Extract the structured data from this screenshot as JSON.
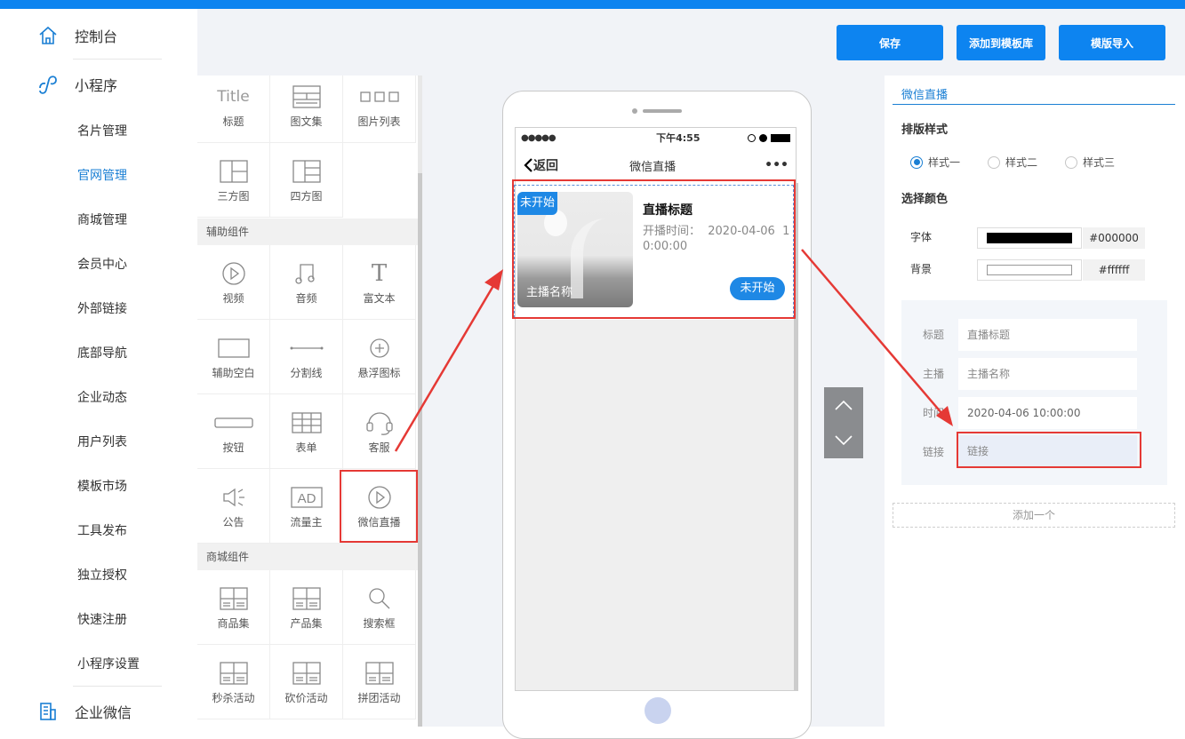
{
  "sidebar": {
    "console": "控制台",
    "miniprogram": "小程序",
    "items": [
      "名片管理",
      "官网管理",
      "商城管理",
      "会员中心",
      "外部链接",
      "底部导航",
      "企业动态",
      "用户列表",
      "模板市场",
      "工具发布",
      "独立授权",
      "快速注册",
      "小程序设置"
    ],
    "active_index": 1,
    "wework": "企业微信"
  },
  "header": {
    "save_label": "保存",
    "add_to_lib_label": "添加到模板库",
    "import_label": "模版导入"
  },
  "components": {
    "basic": [
      {
        "icon": "title-text-icon",
        "icon_text": "Title",
        "label": "标题"
      },
      {
        "icon": "image-text-set-icon",
        "label": "图文集"
      },
      {
        "icon": "image-list-icon",
        "label": "图片列表"
      },
      {
        "icon": "three-grid-icon",
        "label": "三方图"
      },
      {
        "icon": "four-grid-icon",
        "label": "四方图"
      }
    ],
    "aux_title": "辅助组件",
    "aux": [
      {
        "icon": "video-icon",
        "label": "视频"
      },
      {
        "icon": "audio-icon",
        "label": "音频"
      },
      {
        "icon": "rich-text-icon",
        "icon_text": "T",
        "label": "富文本"
      },
      {
        "icon": "blank-space-icon",
        "label": "辅助空白"
      },
      {
        "icon": "divider-icon",
        "label": "分割线"
      },
      {
        "icon": "float-icon",
        "label": "悬浮图标"
      },
      {
        "icon": "button-icon",
        "label": "按钮"
      },
      {
        "icon": "form-icon",
        "label": "表单"
      },
      {
        "icon": "customer-service-icon",
        "label": "客服"
      },
      {
        "icon": "announcement-icon",
        "label": "公告"
      },
      {
        "icon": "ad-icon",
        "icon_text": "AD",
        "label": "流量主"
      },
      {
        "icon": "wechat-live-icon",
        "label": "微信直播"
      }
    ],
    "mall_title": "商城组件",
    "mall": [
      {
        "icon": "goods-set-icon",
        "label": "商品集"
      },
      {
        "icon": "product-set-icon",
        "label": "产品集"
      },
      {
        "icon": "search-box-icon",
        "label": "搜索框"
      },
      {
        "icon": "flash-sale-icon",
        "label": "秒杀活动"
      },
      {
        "icon": "bargain-icon",
        "label": "砍价活动"
      },
      {
        "icon": "group-buy-icon",
        "label": "拼团活动"
      }
    ]
  },
  "phone": {
    "status_time": "下午4:55",
    "signal": "●●●●●",
    "back_label": "返回",
    "page_title": "微信直播",
    "more": "•••",
    "live_card": {
      "badge": "未开始",
      "anchor": "主播名称",
      "title": "直播标题",
      "time_label": "开播时间：",
      "time_value": "2020-04-06 10:00:00",
      "time_line1": "开播时间：  2020-04-06  1",
      "time_line2": "0:00:00",
      "status_button": "未开始"
    }
  },
  "settings": {
    "tab": "微信直播",
    "layout_title": "排版样式",
    "styles": [
      "样式一",
      "样式二",
      "样式三"
    ],
    "selected_style": 0,
    "color_title": "选择颜色",
    "font_label": "字体",
    "font_color": "#000000",
    "bg_label": "背景",
    "bg_color": "#ffffff",
    "fields": [
      {
        "label": "标题",
        "placeholder": "直播标题"
      },
      {
        "label": "主播",
        "placeholder": "主播名称"
      },
      {
        "label": "时间",
        "value": "2020-04-06 10:00:00"
      },
      {
        "label": "链接",
        "placeholder": "链接"
      }
    ],
    "add_one": "添加一个"
  },
  "colors": {
    "accent": "#0d84f0",
    "annotation": "#e53935",
    "live_blue": "#1e88e5"
  }
}
